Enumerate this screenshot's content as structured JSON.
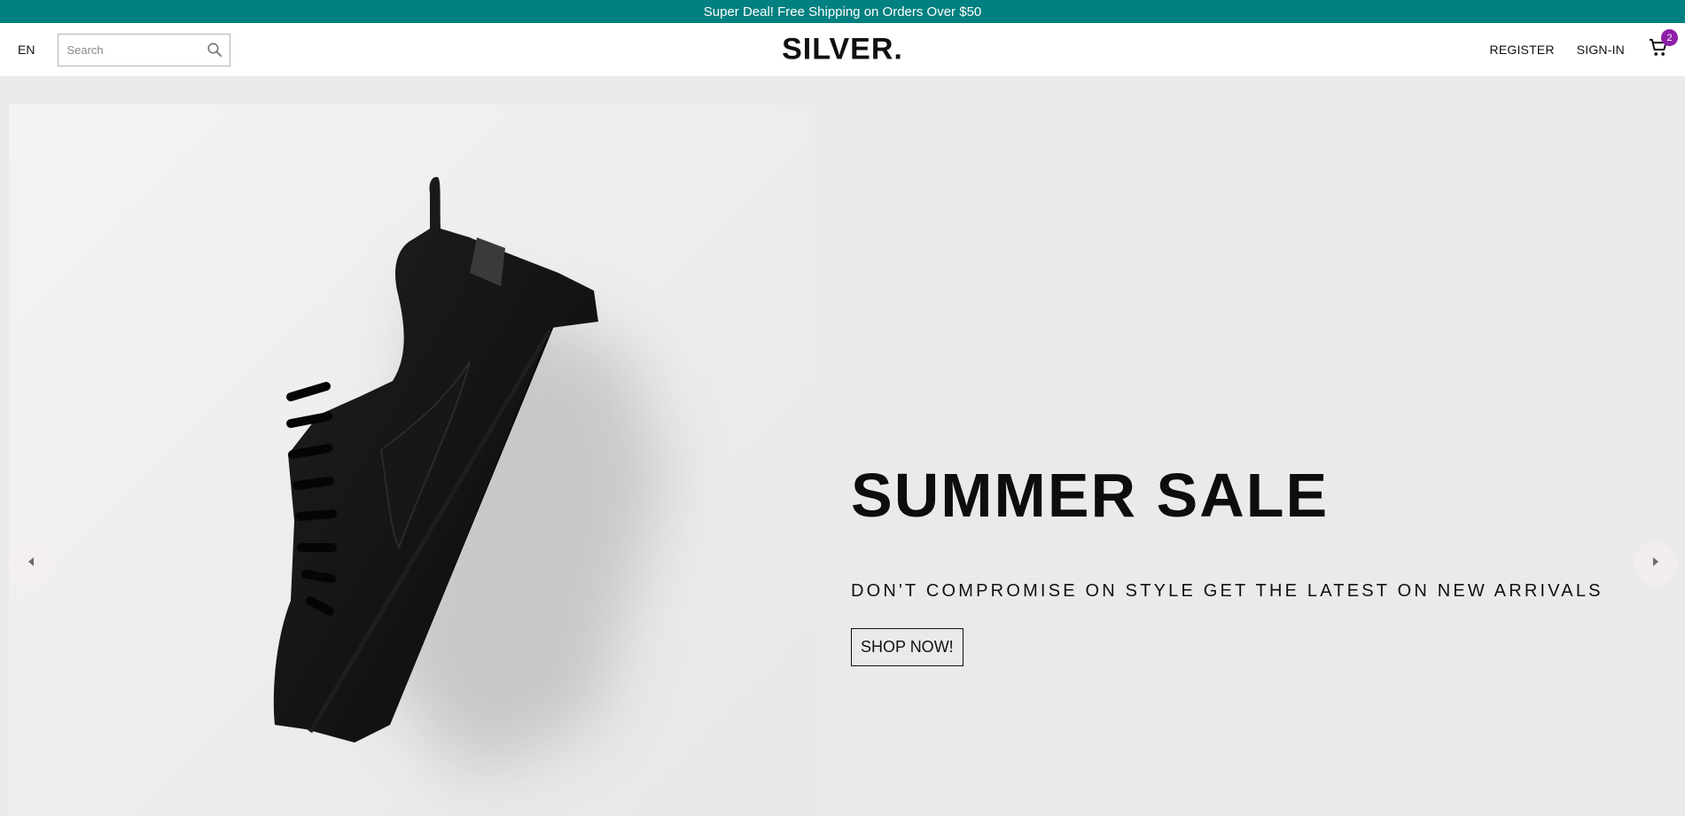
{
  "announcement": {
    "text": "Super Deal! Free Shipping on Orders Over $50",
    "background": "#008080"
  },
  "navbar": {
    "language": "EN",
    "search": {
      "placeholder": "Search",
      "value": "",
      "icon": "search-icon"
    },
    "logo": "SILVER.",
    "register_label": "REGISTER",
    "signin_label": "SIGN-IN",
    "cart": {
      "icon": "shopping-cart-icon",
      "count": "2",
      "badge_color": "#8e1ea8"
    }
  },
  "slider": {
    "background": "#eaeaeb",
    "slide": {
      "image": "black-sneaker-image",
      "title": "SUMMER SALE",
      "description": "DON'T COMPROMISE ON STYLE GET THE LATEST ON NEW ARRIVALS",
      "button_label": "SHOP NOW!"
    },
    "prev_icon": "arrow-left-icon",
    "next_icon": "arrow-right-icon"
  }
}
